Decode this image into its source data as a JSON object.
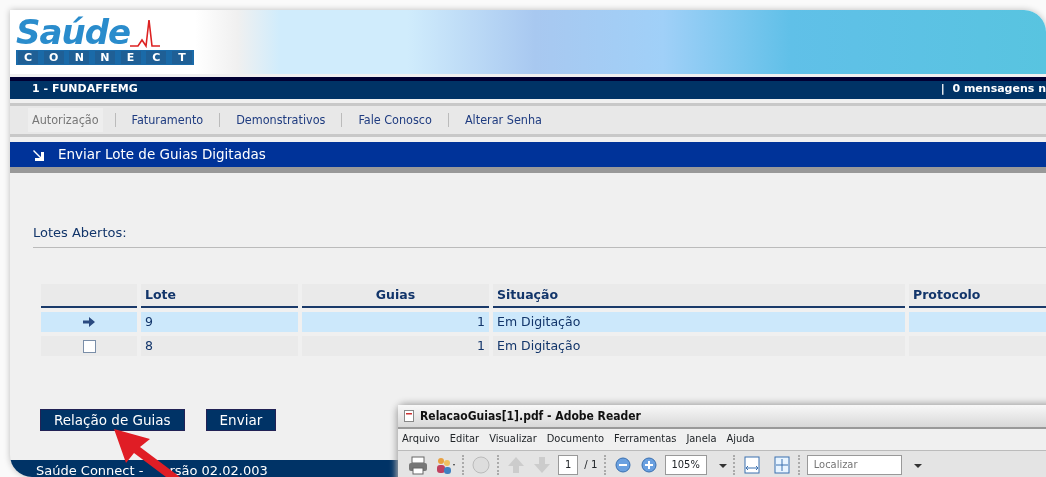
{
  "logo": {
    "word": "Saúde",
    "letters": [
      "C",
      "O",
      "N",
      "N",
      "E",
      "C",
      "T"
    ]
  },
  "user_bar": {
    "account": "1 - FUNDAFFEMG",
    "separator": "|",
    "messages": "0 mensagens n"
  },
  "menu": [
    {
      "label": "Autorização",
      "selected": true
    },
    {
      "label": "Faturamento",
      "selected": false
    },
    {
      "label": "Demonstrativos",
      "selected": false
    },
    {
      "label": "Fale Conosco",
      "selected": false
    },
    {
      "label": "Alterar Senha",
      "selected": false
    }
  ],
  "page_title": "Enviar Lote de Guias Digitadas",
  "section_label": "Lotes Abertos:",
  "table": {
    "columns": [
      "Lote",
      "Guias",
      "Situação",
      "Protocolo"
    ],
    "rows": [
      {
        "selected": true,
        "lote": "9",
        "guias": "1",
        "situacao": "Em Digitação"
      },
      {
        "selected": false,
        "lote": "8",
        "guias": "1",
        "situacao": "Em Digitação"
      }
    ]
  },
  "buttons": [
    "Relação de Guias",
    "Enviar"
  ],
  "footer": [
    "Saúde Connect -",
    "rsão 02.02.003"
  ],
  "reader": {
    "title": "RelacaoGuias[1].pdf - Adobe Reader",
    "menu": [
      "Arquivo",
      "Editar",
      "Visualizar",
      "Documento",
      "Ferramentas",
      "Janela",
      "Ajuda"
    ],
    "page": "1",
    "page_total": "/ 1",
    "zoom": "105%",
    "search_placeholder": "Localizar"
  }
}
